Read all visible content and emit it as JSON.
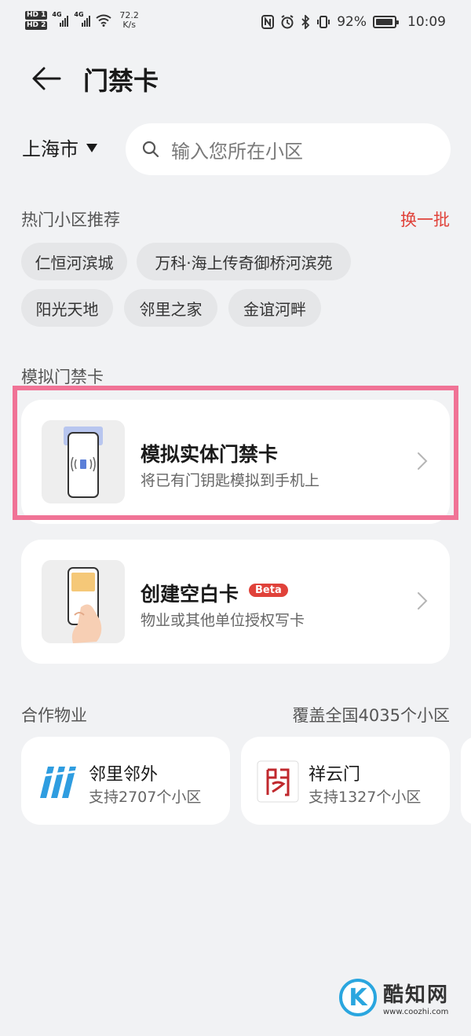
{
  "status_bar": {
    "hd1": "HD 1",
    "hd2": "HD 2",
    "net1": "4G",
    "net2": "4G",
    "speed_value": "72.2",
    "speed_unit": "K/s",
    "battery": "92%",
    "time": "10:09"
  },
  "header": {
    "title": "门禁卡"
  },
  "search": {
    "city": "上海市",
    "placeholder": "输入您所在小区"
  },
  "hot": {
    "label": "热门小区推荐",
    "refresh": "换一批",
    "chips": [
      "仁恒河滨城",
      "万科·海上传奇御桥河滨苑",
      "阳光天地",
      "邻里之家",
      "金谊河畔"
    ]
  },
  "simulate": {
    "label": "模拟门禁卡",
    "card_title": "模拟实体门禁卡",
    "card_sub": "将已有门钥匙模拟到手机上"
  },
  "blank": {
    "card_title": "创建空白卡",
    "badge": "Beta",
    "card_sub": "物业或其他单位授权写卡"
  },
  "partners": {
    "label": "合作物业",
    "coverage": "覆盖全国4035个小区",
    "items": [
      {
        "name": "邻里邻外",
        "count": "支持2707个小区"
      },
      {
        "name": "祥云门",
        "count": "支持1327个小区"
      }
    ]
  },
  "watermark": {
    "name": "酷知网",
    "url": "www.coozhi.com"
  },
  "colors": {
    "accent_red": "#e0423a",
    "highlight_pink": "#f07396",
    "background": "#f1f2f4"
  }
}
